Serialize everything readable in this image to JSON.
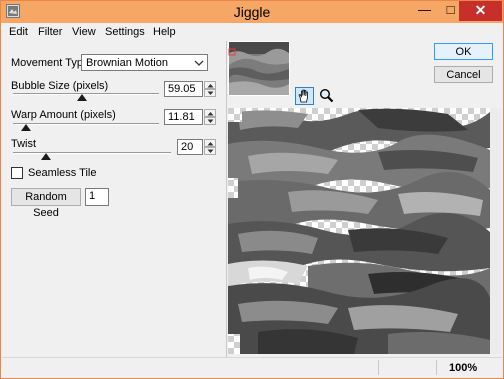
{
  "window": {
    "title": "Jiggle",
    "close_glyph": "✕",
    "min_glyph": "—",
    "max_glyph": "□"
  },
  "menu": [
    "Edit",
    "Filter",
    "View",
    "Settings",
    "Help"
  ],
  "movement": {
    "label": "Movement Type:",
    "value": "Brownian Motion"
  },
  "bubble_size": {
    "label": "Bubble Size (pixels)",
    "value": "59.05",
    "slider_fraction": 0.47
  },
  "warp_amount": {
    "label": "Warp Amount (pixels)",
    "value": "11.81",
    "slider_fraction": 0.09
  },
  "twist": {
    "label": "Twist",
    "value": "20",
    "slider_fraction": 0.21
  },
  "seamless": {
    "label": "Seamless Tile",
    "checked": false
  },
  "random_seed": {
    "button_label": "Random Seed",
    "value": "1"
  },
  "buttons": {
    "ok": "OK",
    "cancel": "Cancel"
  },
  "tools": {
    "hand": "hand-tool-icon",
    "zoom": "zoom-tool-icon"
  },
  "status": {
    "zoom": "100%"
  },
  "colors": {
    "titlebar": "#f6a766",
    "close": "#c7302a",
    "accent": "#3399ff"
  }
}
